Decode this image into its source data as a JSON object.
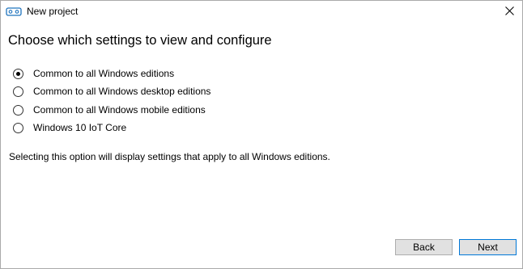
{
  "window": {
    "title": "New project"
  },
  "dialog": {
    "heading": "Choose which settings to view and configure",
    "options": [
      {
        "label": "Common to all Windows editions",
        "selected": true
      },
      {
        "label": "Common to all Windows desktop editions",
        "selected": false
      },
      {
        "label": "Common to all Windows mobile editions",
        "selected": false
      },
      {
        "label": "Windows 10 IoT Core",
        "selected": false
      }
    ],
    "description": "Selecting this option will display settings that apply to all Windows editions."
  },
  "buttons": {
    "back_label": "Back",
    "next_label": "Next"
  },
  "icons": {
    "app": "vr-headset-icon",
    "close": "close-icon"
  },
  "colors": {
    "accent_border": "#0078d7",
    "button_bg": "#e1e1e1"
  }
}
